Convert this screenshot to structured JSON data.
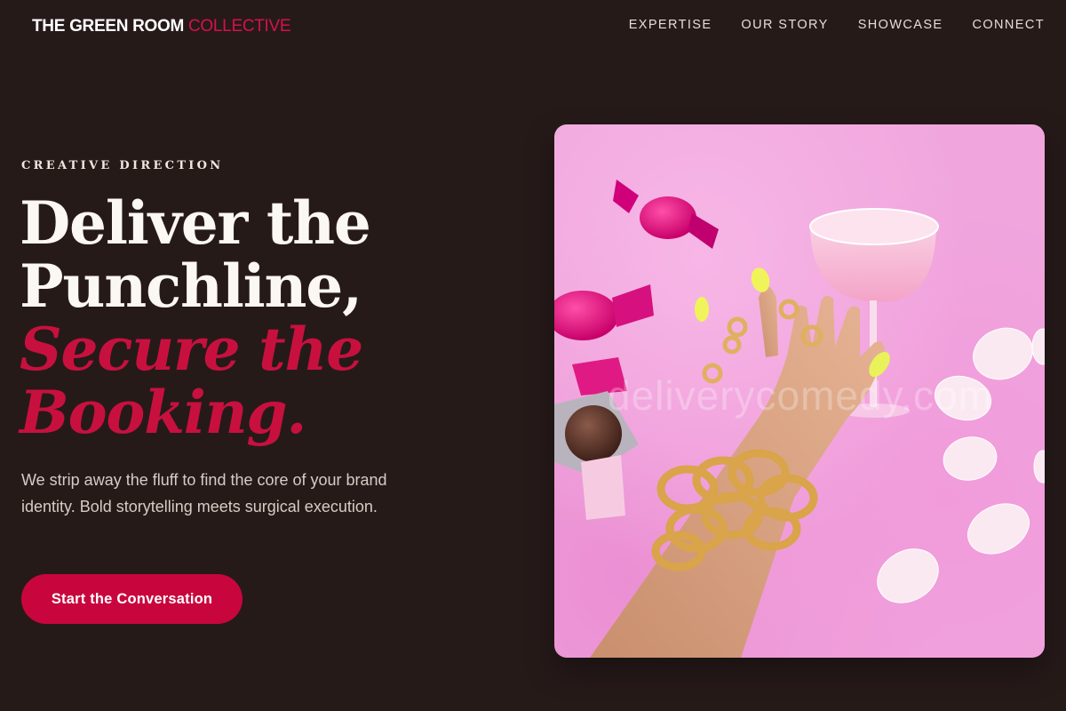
{
  "header": {
    "brand_primary": "THE GREEN ROOM",
    "brand_accent": "COLLECTIVE",
    "nav": [
      "EXPERTISE",
      "OUR STORY",
      "SHOWCASE",
      "CONNECT"
    ]
  },
  "hero": {
    "eyebrow": "CREATIVE DIRECTION",
    "headline_line1": "Deliver the",
    "headline_line2": "Punchline,",
    "headline_line3": "Secure the",
    "headline_line4": "Booking.",
    "lede": "We strip away the fluff to find the core of your brand identity. Bold storytelling meets surgical execution.",
    "cta_label": "Start the Conversation"
  },
  "image": {
    "watermark": "deliverycomedy.com"
  },
  "colors": {
    "background": "#261a19",
    "accent": "#c8063d",
    "heading": "#fbf7f3"
  },
  "icons": {
    "photo": "hand-with-cocktail-photo"
  }
}
